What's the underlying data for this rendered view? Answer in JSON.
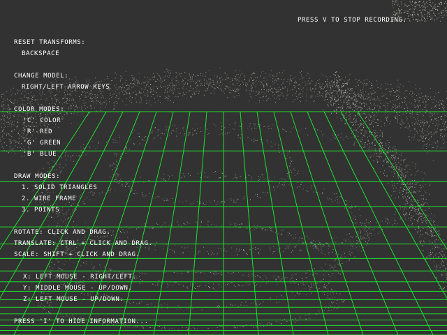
{
  "recording_notice": "PRESS V TO STOP RECORDING.",
  "info": {
    "reset_title": "RESET TRANSFORMS:",
    "reset_key": "BACKSPACE",
    "model_title": "CHANGE MODEL:",
    "model_key": "RIGHT/LEFT ARROW KEYS",
    "color_title": "COLOR MODES:",
    "color_modes": [
      "'C' COLOR",
      "'R' RED",
      "'G' GREEN",
      "'B' BLUE"
    ],
    "draw_title": "DRAW MODES:",
    "draw_modes": [
      "1. SOLID TRIANGLES",
      "2. WIRE FRAME",
      "3. POINTS"
    ],
    "rotate": "ROTATE: CLICK AND DRAG.",
    "translate": "TRANSLATE: CTRL + CLICK AND DRAG.",
    "scale": "SCALE: SHIFT + CLICK AND DRAG.",
    "axes": [
      "X: LEFT MOUSE - RIGHT/LEFT.",
      "Y: MIDDLE MOUSE - UP/DOWN.",
      "Z: LEFT MOUSE - UP/DOWN."
    ],
    "hide_hint": "PRESS 'I' TO HIDE INFORMATION..."
  },
  "colors": {
    "background": "#323232",
    "grid": "#1fe02f",
    "points": "#d9d9c8",
    "text": "#ffffff"
  }
}
